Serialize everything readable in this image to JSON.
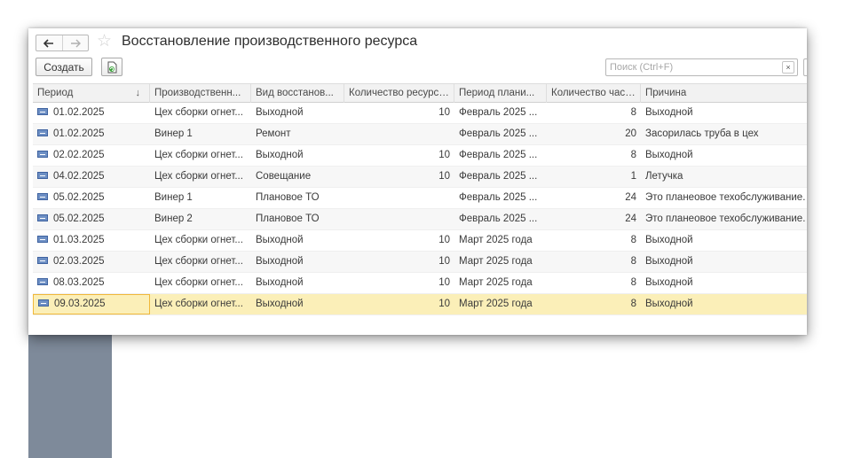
{
  "window": {
    "title": "Восстановление производственного ресурса"
  },
  "toolbar": {
    "create_label": "Создать",
    "search_placeholder": "Поиск (Ctrl+F)",
    "clear_label": "×"
  },
  "nav": {
    "back": "🡐",
    "forward": "→",
    "star": "☆"
  },
  "table": {
    "columns": [
      {
        "label": "Период",
        "sort": "↓"
      },
      {
        "label": "Производственн..."
      },
      {
        "label": "Вид восстанов..."
      },
      {
        "label": "Количество ресурсов"
      },
      {
        "label": "Период плани..."
      },
      {
        "label": "Количество часов"
      },
      {
        "label": "Причина"
      }
    ],
    "rows": [
      {
        "period": "01.02.2025",
        "resource": "Цех сборки огнет...",
        "kind": "Выходной",
        "count": "10",
        "plan": "Февраль 2025 ...",
        "hours": "8",
        "reason": "Выходной"
      },
      {
        "period": "01.02.2025",
        "resource": "Винер 1",
        "kind": "Ремонт",
        "count": "",
        "plan": "Февраль 2025 ...",
        "hours": "20",
        "reason": "Засорилась труба в цех"
      },
      {
        "period": "02.02.2025",
        "resource": "Цех сборки огнет...",
        "kind": "Выходной",
        "count": "10",
        "plan": "Февраль 2025 ...",
        "hours": "8",
        "reason": "Выходной"
      },
      {
        "period": "04.02.2025",
        "resource": "Цех сборки огнет...",
        "kind": "Совещание",
        "count": "10",
        "plan": "Февраль 2025 ...",
        "hours": "1",
        "reason": "Летучка"
      },
      {
        "period": "05.02.2025",
        "resource": "Винер 1",
        "kind": "Плановое ТО",
        "count": "",
        "plan": "Февраль 2025 ...",
        "hours": "24",
        "reason": "Это планеовое техобслуживание."
      },
      {
        "period": "05.02.2025",
        "resource": "Винер 2",
        "kind": "Плановое ТО",
        "count": "",
        "plan": "Февраль 2025 ...",
        "hours": "24",
        "reason": "Это планеовое техобслуживание."
      },
      {
        "period": "01.03.2025",
        "resource": "Цех сборки огнет...",
        "kind": "Выходной",
        "count": "10",
        "plan": "Март 2025 года",
        "hours": "8",
        "reason": "Выходной"
      },
      {
        "period": "02.03.2025",
        "resource": "Цех сборки огнет...",
        "kind": "Выходной",
        "count": "10",
        "plan": "Март 2025 года",
        "hours": "8",
        "reason": "Выходной"
      },
      {
        "period": "08.03.2025",
        "resource": "Цех сборки огнет...",
        "kind": "Выходной",
        "count": "10",
        "plan": "Март 2025 года",
        "hours": "8",
        "reason": "Выходной"
      },
      {
        "period": "09.03.2025",
        "resource": "Цех сборки огнет...",
        "kind": "Выходной",
        "count": "10",
        "plan": "Март 2025 года",
        "hours": "8",
        "reason": "Выходной",
        "selected": true
      }
    ]
  },
  "colors": {
    "selected_row": "#fbefb8",
    "selected_border": "#f0b83a",
    "side_panel": "#7e8a9a"
  }
}
